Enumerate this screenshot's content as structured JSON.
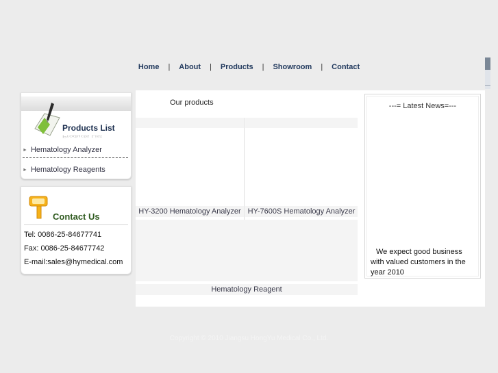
{
  "nav": {
    "items": [
      "Home",
      "About",
      "Products",
      "Showroom",
      "Contact"
    ],
    "separator": "|"
  },
  "products_list": {
    "title": "Products List",
    "title_reflection": "Products List",
    "items": [
      "Hematology Analyzer",
      "Hematology Reagents"
    ]
  },
  "contact": {
    "title": "Contact Us",
    "tel": "Tel: 0086-25-84677741",
    "fax": "Fax: 0086-25-84677742",
    "email": "E-mail:sales@hymedical.com"
  },
  "main": {
    "heading": "Our products",
    "products": [
      "HY-3200 Hematology Analyzer",
      "HY-7600S Hematology Analyzer",
      "Hematology Reagent"
    ]
  },
  "news": {
    "title": "---= Latest News=---",
    "body": "We expect good business with valued customers in the year 2010"
  },
  "footer": {
    "copyright": "Copyright © 2010 Jiangsu HongYu Medical Co., Ltd."
  },
  "colors": {
    "nav_text": "#223a5e",
    "page_bg": "#ececec",
    "products_title": "#1c2f4f",
    "contact_title": "#2f5a1f"
  }
}
